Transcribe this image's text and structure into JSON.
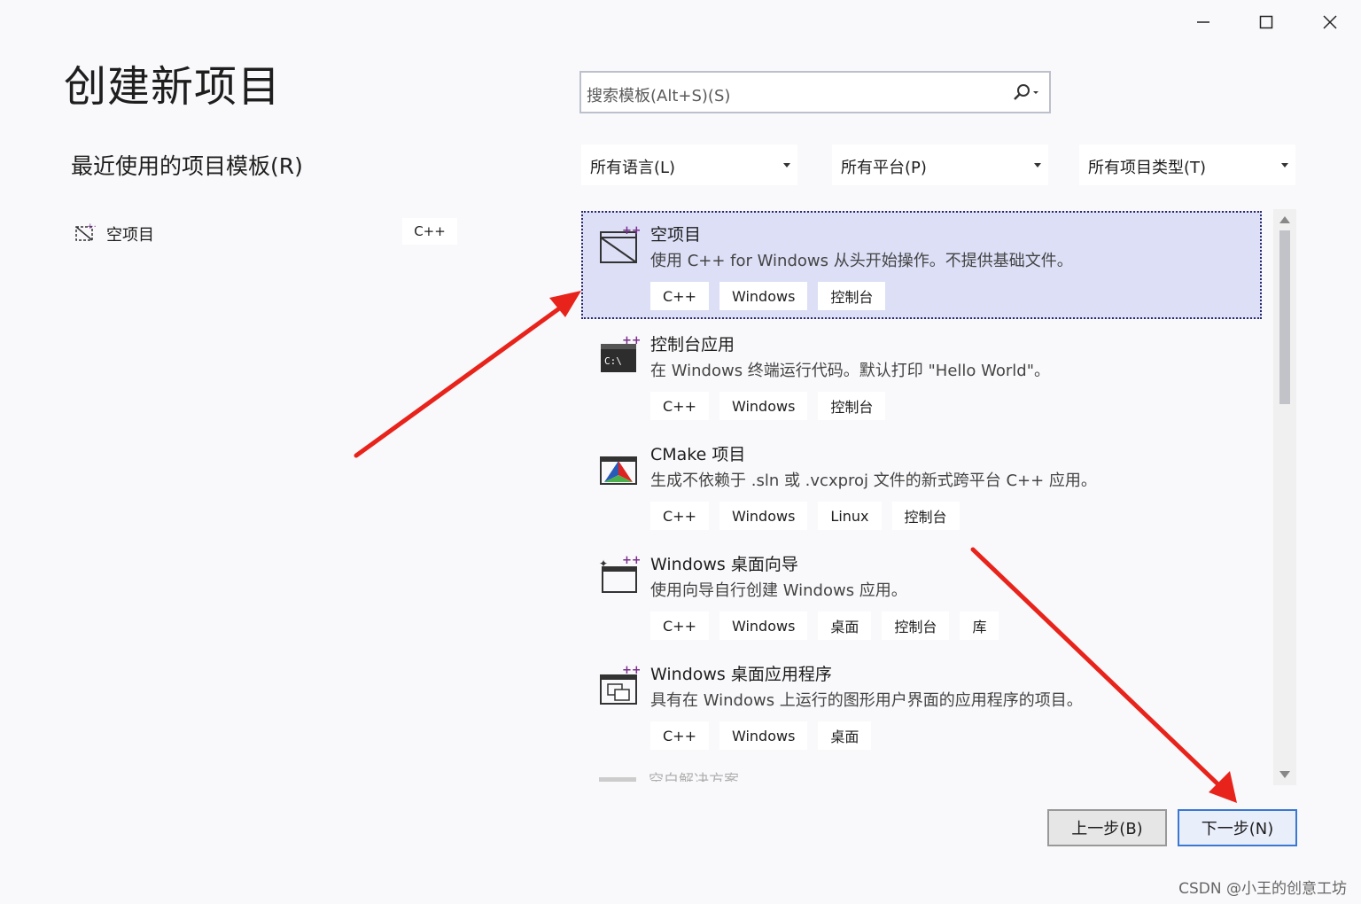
{
  "window": {
    "minimize_icon": "minimize-icon",
    "maximize_icon": "maximize-icon",
    "close_icon": "close-icon"
  },
  "page_title": "创建新项目",
  "recent": {
    "title": "最近使用的项目模板(R)",
    "items": [
      {
        "label": "空项目",
        "tag": "C++"
      }
    ]
  },
  "search": {
    "placeholder": "搜索模板(Alt+S)(S)"
  },
  "filters": [
    {
      "label": "所有语言(L)"
    },
    {
      "label": "所有平台(P)"
    },
    {
      "label": "所有项目类型(T)"
    }
  ],
  "templates": [
    {
      "name": "空项目",
      "desc": "使用 C++ for Windows 从头开始操作。不提供基础文件。",
      "tags": [
        "C++",
        "Windows",
        "控制台"
      ],
      "icon": "empty-project-icon",
      "selected": true
    },
    {
      "name": "控制台应用",
      "desc": "在 Windows 终端运行代码。默认打印 \"Hello World\"。",
      "tags": [
        "C++",
        "Windows",
        "控制台"
      ],
      "icon": "console-app-icon"
    },
    {
      "name": "CMake 项目",
      "desc": "生成不依赖于 .sln 或 .vcxproj 文件的新式跨平台 C++ 应用。",
      "tags": [
        "C++",
        "Windows",
        "Linux",
        "控制台"
      ],
      "icon": "cmake-icon"
    },
    {
      "name": "Windows 桌面向导",
      "desc": "使用向导自行创建 Windows 应用。",
      "tags": [
        "C++",
        "Windows",
        "桌面",
        "控制台",
        "库"
      ],
      "icon": "desktop-wizard-icon"
    },
    {
      "name": "Windows 桌面应用程序",
      "desc": "具有在 Windows 上运行的图形用户界面的应用程序的项目。",
      "tags": [
        "C++",
        "Windows",
        "桌面"
      ],
      "icon": "desktop-app-icon"
    }
  ],
  "partial_item": "空白解决方案",
  "buttons": {
    "back": "上一步(B)",
    "next": "下一步(N)"
  },
  "watermark": "CSDN @小王的创意工坊",
  "colors": {
    "selected_bg": "#dcdff6",
    "accent": "#3a78d4",
    "arrow": "#e8231b"
  }
}
